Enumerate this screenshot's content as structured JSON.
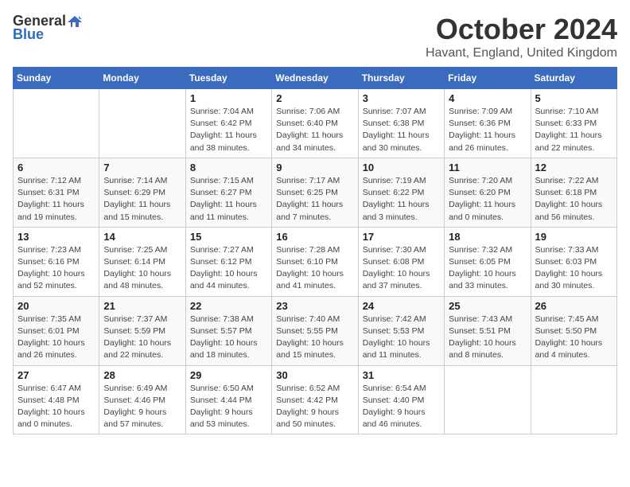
{
  "logo": {
    "general": "General",
    "blue": "Blue"
  },
  "title": "October 2024",
  "location": "Havant, England, United Kingdom",
  "days_of_week": [
    "Sunday",
    "Monday",
    "Tuesday",
    "Wednesday",
    "Thursday",
    "Friday",
    "Saturday"
  ],
  "weeks": [
    [
      {
        "day": "",
        "sunrise": "",
        "sunset": "",
        "daylight": ""
      },
      {
        "day": "",
        "sunrise": "",
        "sunset": "",
        "daylight": ""
      },
      {
        "day": "1",
        "sunrise": "Sunrise: 7:04 AM",
        "sunset": "Sunset: 6:42 PM",
        "daylight": "Daylight: 11 hours and 38 minutes."
      },
      {
        "day": "2",
        "sunrise": "Sunrise: 7:06 AM",
        "sunset": "Sunset: 6:40 PM",
        "daylight": "Daylight: 11 hours and 34 minutes."
      },
      {
        "day": "3",
        "sunrise": "Sunrise: 7:07 AM",
        "sunset": "Sunset: 6:38 PM",
        "daylight": "Daylight: 11 hours and 30 minutes."
      },
      {
        "day": "4",
        "sunrise": "Sunrise: 7:09 AM",
        "sunset": "Sunset: 6:36 PM",
        "daylight": "Daylight: 11 hours and 26 minutes."
      },
      {
        "day": "5",
        "sunrise": "Sunrise: 7:10 AM",
        "sunset": "Sunset: 6:33 PM",
        "daylight": "Daylight: 11 hours and 22 minutes."
      }
    ],
    [
      {
        "day": "6",
        "sunrise": "Sunrise: 7:12 AM",
        "sunset": "Sunset: 6:31 PM",
        "daylight": "Daylight: 11 hours and 19 minutes."
      },
      {
        "day": "7",
        "sunrise": "Sunrise: 7:14 AM",
        "sunset": "Sunset: 6:29 PM",
        "daylight": "Daylight: 11 hours and 15 minutes."
      },
      {
        "day": "8",
        "sunrise": "Sunrise: 7:15 AM",
        "sunset": "Sunset: 6:27 PM",
        "daylight": "Daylight: 11 hours and 11 minutes."
      },
      {
        "day": "9",
        "sunrise": "Sunrise: 7:17 AM",
        "sunset": "Sunset: 6:25 PM",
        "daylight": "Daylight: 11 hours and 7 minutes."
      },
      {
        "day": "10",
        "sunrise": "Sunrise: 7:19 AM",
        "sunset": "Sunset: 6:22 PM",
        "daylight": "Daylight: 11 hours and 3 minutes."
      },
      {
        "day": "11",
        "sunrise": "Sunrise: 7:20 AM",
        "sunset": "Sunset: 6:20 PM",
        "daylight": "Daylight: 11 hours and 0 minutes."
      },
      {
        "day": "12",
        "sunrise": "Sunrise: 7:22 AM",
        "sunset": "Sunset: 6:18 PM",
        "daylight": "Daylight: 10 hours and 56 minutes."
      }
    ],
    [
      {
        "day": "13",
        "sunrise": "Sunrise: 7:23 AM",
        "sunset": "Sunset: 6:16 PM",
        "daylight": "Daylight: 10 hours and 52 minutes."
      },
      {
        "day": "14",
        "sunrise": "Sunrise: 7:25 AM",
        "sunset": "Sunset: 6:14 PM",
        "daylight": "Daylight: 10 hours and 48 minutes."
      },
      {
        "day": "15",
        "sunrise": "Sunrise: 7:27 AM",
        "sunset": "Sunset: 6:12 PM",
        "daylight": "Daylight: 10 hours and 44 minutes."
      },
      {
        "day": "16",
        "sunrise": "Sunrise: 7:28 AM",
        "sunset": "Sunset: 6:10 PM",
        "daylight": "Daylight: 10 hours and 41 minutes."
      },
      {
        "day": "17",
        "sunrise": "Sunrise: 7:30 AM",
        "sunset": "Sunset: 6:08 PM",
        "daylight": "Daylight: 10 hours and 37 minutes."
      },
      {
        "day": "18",
        "sunrise": "Sunrise: 7:32 AM",
        "sunset": "Sunset: 6:05 PM",
        "daylight": "Daylight: 10 hours and 33 minutes."
      },
      {
        "day": "19",
        "sunrise": "Sunrise: 7:33 AM",
        "sunset": "Sunset: 6:03 PM",
        "daylight": "Daylight: 10 hours and 30 minutes."
      }
    ],
    [
      {
        "day": "20",
        "sunrise": "Sunrise: 7:35 AM",
        "sunset": "Sunset: 6:01 PM",
        "daylight": "Daylight: 10 hours and 26 minutes."
      },
      {
        "day": "21",
        "sunrise": "Sunrise: 7:37 AM",
        "sunset": "Sunset: 5:59 PM",
        "daylight": "Daylight: 10 hours and 22 minutes."
      },
      {
        "day": "22",
        "sunrise": "Sunrise: 7:38 AM",
        "sunset": "Sunset: 5:57 PM",
        "daylight": "Daylight: 10 hours and 18 minutes."
      },
      {
        "day": "23",
        "sunrise": "Sunrise: 7:40 AM",
        "sunset": "Sunset: 5:55 PM",
        "daylight": "Daylight: 10 hours and 15 minutes."
      },
      {
        "day": "24",
        "sunrise": "Sunrise: 7:42 AM",
        "sunset": "Sunset: 5:53 PM",
        "daylight": "Daylight: 10 hours and 11 minutes."
      },
      {
        "day": "25",
        "sunrise": "Sunrise: 7:43 AM",
        "sunset": "Sunset: 5:51 PM",
        "daylight": "Daylight: 10 hours and 8 minutes."
      },
      {
        "day": "26",
        "sunrise": "Sunrise: 7:45 AM",
        "sunset": "Sunset: 5:50 PM",
        "daylight": "Daylight: 10 hours and 4 minutes."
      }
    ],
    [
      {
        "day": "27",
        "sunrise": "Sunrise: 6:47 AM",
        "sunset": "Sunset: 4:48 PM",
        "daylight": "Daylight: 10 hours and 0 minutes."
      },
      {
        "day": "28",
        "sunrise": "Sunrise: 6:49 AM",
        "sunset": "Sunset: 4:46 PM",
        "daylight": "Daylight: 9 hours and 57 minutes."
      },
      {
        "day": "29",
        "sunrise": "Sunrise: 6:50 AM",
        "sunset": "Sunset: 4:44 PM",
        "daylight": "Daylight: 9 hours and 53 minutes."
      },
      {
        "day": "30",
        "sunrise": "Sunrise: 6:52 AM",
        "sunset": "Sunset: 4:42 PM",
        "daylight": "Daylight: 9 hours and 50 minutes."
      },
      {
        "day": "31",
        "sunrise": "Sunrise: 6:54 AM",
        "sunset": "Sunset: 4:40 PM",
        "daylight": "Daylight: 9 hours and 46 minutes."
      },
      {
        "day": "",
        "sunrise": "",
        "sunset": "",
        "daylight": ""
      },
      {
        "day": "",
        "sunrise": "",
        "sunset": "",
        "daylight": ""
      }
    ]
  ]
}
